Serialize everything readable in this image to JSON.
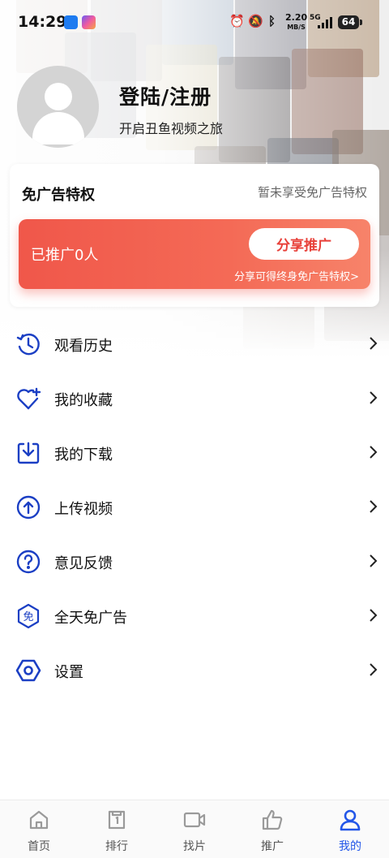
{
  "status_bar": {
    "time": "14:29",
    "net_speed": "2.20",
    "net_unit": "MB/S",
    "signal": "5G",
    "battery": "64"
  },
  "profile": {
    "login_label": "登陆/注册",
    "subtitle": "开启丑鱼视频之旅"
  },
  "ad_free": {
    "title": "免广告特权",
    "status": "暂未享受免广告特权",
    "promoted_count": "已推广0人",
    "share_button": "分享推广",
    "hint": "分享可得终身免广告特权>"
  },
  "menu": [
    {
      "label": "观看历史",
      "icon": "history-icon"
    },
    {
      "label": "我的收藏",
      "icon": "heart-plus-icon"
    },
    {
      "label": "我的下载",
      "icon": "download-icon"
    },
    {
      "label": "上传视频",
      "icon": "upload-icon"
    },
    {
      "label": "意见反馈",
      "icon": "question-icon"
    },
    {
      "label": "全天免广告",
      "icon": "ad-free-icon"
    },
    {
      "label": "设置",
      "icon": "settings-icon"
    }
  ],
  "tabs": [
    {
      "label": "首页",
      "icon": "home-icon"
    },
    {
      "label": "排行",
      "icon": "ranking-icon"
    },
    {
      "label": "找片",
      "icon": "video-camera-icon"
    },
    {
      "label": "推广",
      "icon": "thumbs-up-icon"
    },
    {
      "label": "我的",
      "icon": "user-icon",
      "active": true
    }
  ],
  "colors": {
    "accent_blue": "#2256e8",
    "promo_red": "#f0574a",
    "icon_blue": "#1b3fc4"
  }
}
